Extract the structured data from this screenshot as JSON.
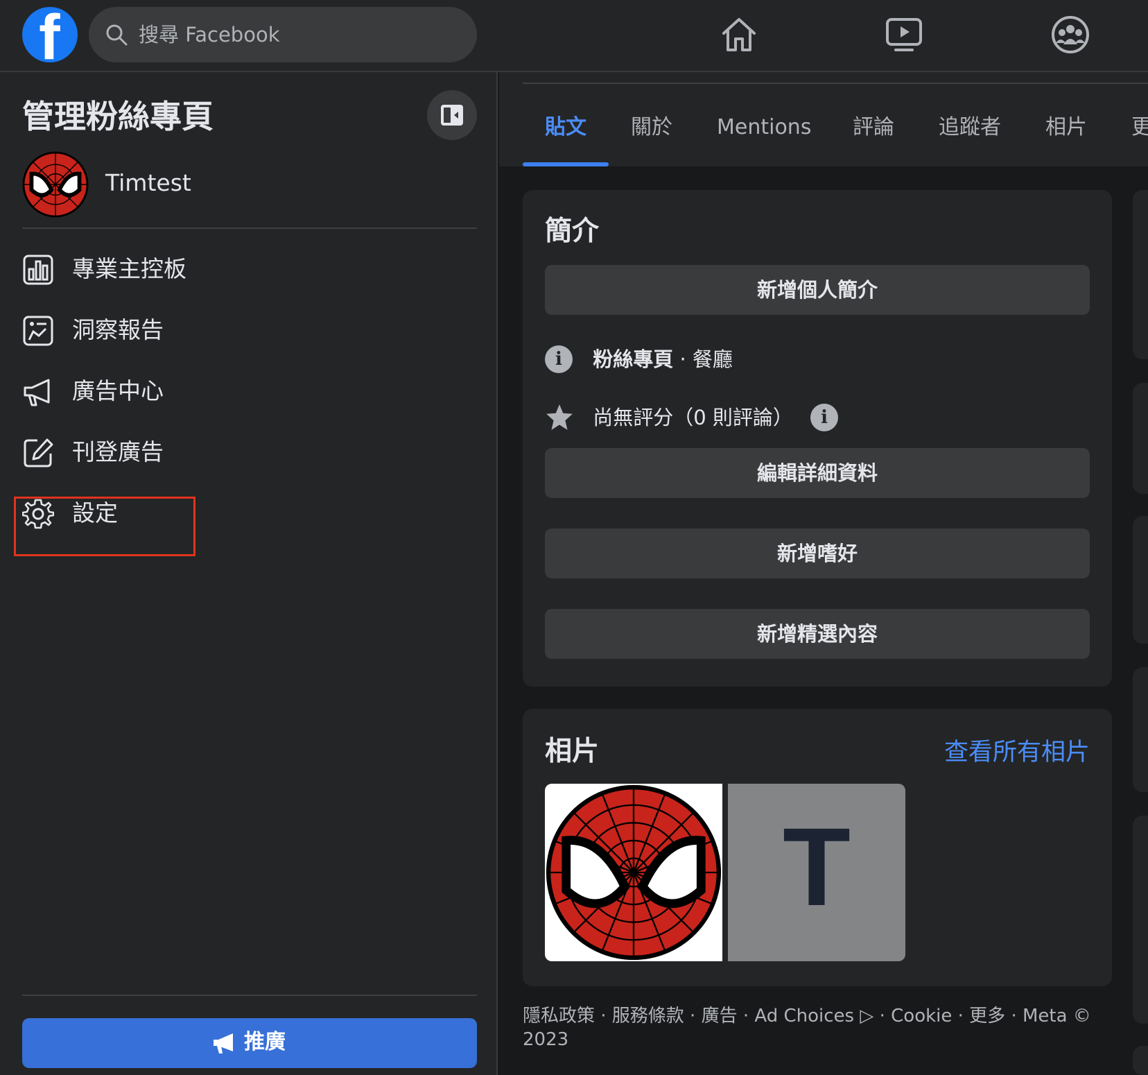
{
  "topbar": {
    "logo_letter": "f",
    "search_placeholder": "搜尋 Facebook"
  },
  "sidebar": {
    "title": "管理粉絲專頁",
    "page_name": "Timtest",
    "menu": [
      {
        "label": "專業主控板",
        "icon": "dashboard-icon"
      },
      {
        "label": "洞察報告",
        "icon": "insights-icon"
      },
      {
        "label": "廣告中心",
        "icon": "megaphone-icon"
      },
      {
        "label": "刊登廣告",
        "icon": "edit-icon"
      },
      {
        "label": "設定",
        "icon": "gear-icon"
      }
    ],
    "promote_label": "推廣"
  },
  "tabs": [
    {
      "label": "貼文",
      "active": true
    },
    {
      "label": "關於"
    },
    {
      "label": "Mentions"
    },
    {
      "label": "評論"
    },
    {
      "label": "追蹤者"
    },
    {
      "label": "相片"
    },
    {
      "label": "更"
    }
  ],
  "intro": {
    "title": "簡介",
    "add_bio": "新增個人簡介",
    "category_bold": "粉絲專頁",
    "category_rest": " · 餐廳",
    "rating": "尚無評分（0 則評論）",
    "edit_details": "編輯詳細資料",
    "add_hobbies": "新增嗜好",
    "add_featured": "新增精選內容"
  },
  "photos": {
    "title": "相片",
    "see_all": "查看所有相片",
    "tile_letter": "T"
  },
  "footer": {
    "text": "隱私政策 · 服務條款 · 廣告 · Ad Choices ▷ · Cookie · 更多 · Meta © 2023"
  },
  "colors": {
    "accent": "#3670d8",
    "link": "#4b8df8",
    "highlight": "#e0341e"
  }
}
